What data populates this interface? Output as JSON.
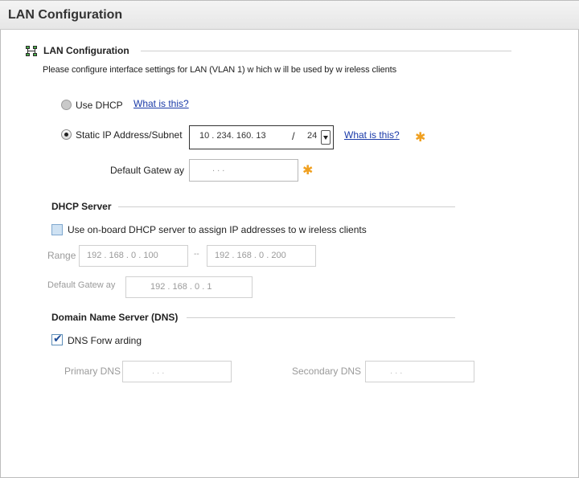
{
  "header": {
    "title": "LAN Configuration"
  },
  "lan": {
    "section_title": "LAN Configuration",
    "description": "Please configure interface settings for LAN (VLAN 1) w hich w ill be used by w ireless clients",
    "use_dhcp_label": "Use DHCP",
    "what_is_this_1": "What is this?",
    "static_label": "Static IP Address/Subnet",
    "static_ip": "10 .  234.  160.  13",
    "slash": "/",
    "prefix": "24",
    "what_is_this_2": "What is this?",
    "gateway_label": "Default Gatew ay",
    "gateway_value": ".      .      .",
    "required_mark": "✱"
  },
  "dhcp": {
    "section_title": "DHCP Server",
    "checkbox_label": "Use on-board DHCP server to assign IP addresses to w ireless clients",
    "range_label": "Range",
    "range_start": "192 .  168 .   0  . 100",
    "range_sep": "--",
    "range_end": "192 .  168 .   0  . 200",
    "gateway_label": "Default Gatew ay",
    "gateway_value": "192 .  168 .   0  .   1"
  },
  "dns": {
    "section_title": "Domain Name Server (DNS)",
    "forwarding_label": "DNS Forw arding",
    "primary_label": "Primary DNS",
    "primary_value": ".        .        .",
    "secondary_label": "Secondary DNS",
    "secondary_value": ".        .        ."
  }
}
